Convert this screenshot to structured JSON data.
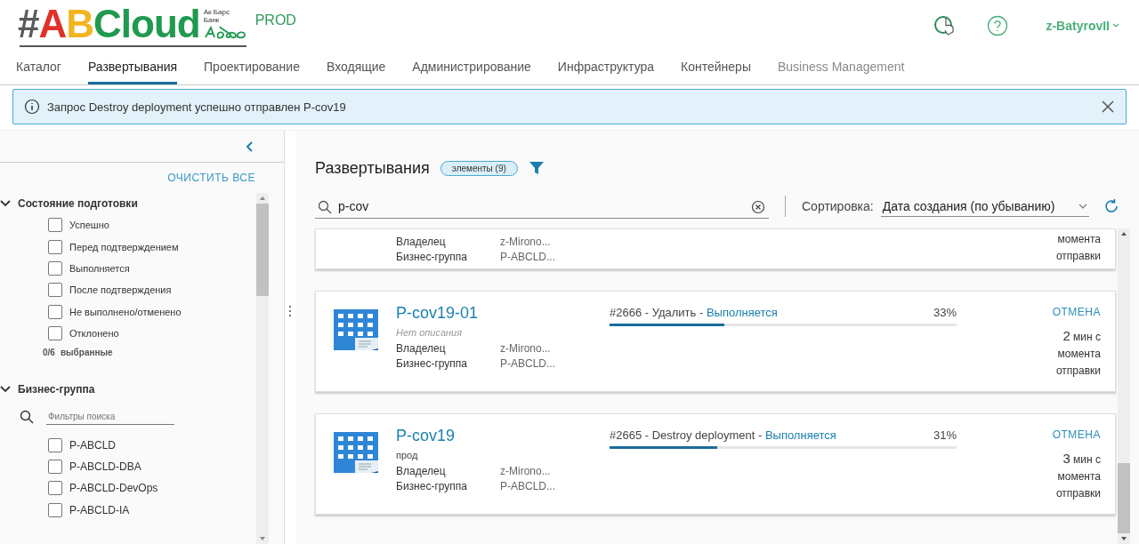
{
  "header": {
    "logo_parts": [
      {
        "text": "#",
        "color": "#5a5a5a"
      },
      {
        "text": "A",
        "color": "#e0302a"
      },
      {
        "text": "B",
        "color": "#f2b520"
      },
      {
        "text": "Cloud",
        "color": "#1f9a4e"
      }
    ],
    "bank_name": "Ак Барс Банк",
    "environment": "PROD",
    "user": "z-BatyrovII"
  },
  "tabs": [
    {
      "label": "Каталог",
      "selected": false,
      "disabled": false
    },
    {
      "label": "Развертывания",
      "selected": true,
      "disabled": false
    },
    {
      "label": "Проектирование",
      "selected": false,
      "disabled": false
    },
    {
      "label": "Входящие",
      "selected": false,
      "disabled": false
    },
    {
      "label": "Администрирование",
      "selected": false,
      "disabled": false
    },
    {
      "label": "Инфраструктура",
      "selected": false,
      "disabled": false
    },
    {
      "label": "Контейнеры",
      "selected": false,
      "disabled": false
    },
    {
      "label": "Business Management",
      "selected": false,
      "disabled": true
    }
  ],
  "alert": {
    "message": "Запрос Destroy deployment успешно отправлен P-cov19"
  },
  "sidebar": {
    "clear_all": "ОЧИСТИТЬ ВСЕ",
    "groups": [
      {
        "title": "Состояние подготовки",
        "expanded": true,
        "items": [
          {
            "label": "Успешно",
            "checked": false
          },
          {
            "label": "Перед подтверждением",
            "checked": false
          },
          {
            "label": "Выполняется",
            "checked": false
          },
          {
            "label": "После подтверждения",
            "checked": false
          },
          {
            "label": "Не выполнено/отменено",
            "checked": false
          },
          {
            "label": "Отклонено",
            "checked": false
          }
        ],
        "count": "0/6",
        "count_label": "выбранные"
      },
      {
        "title": "Бизнес-группа",
        "expanded": true,
        "search_placeholder": "Фильтры поиска",
        "items": [
          {
            "label": "P-ABCLD",
            "checked": false
          },
          {
            "label": "P-ABCLD-DBA",
            "checked": false
          },
          {
            "label": "P-ABCLD-DevOps",
            "checked": false
          },
          {
            "label": "P-ABCLD-IA",
            "checked": false
          }
        ]
      }
    ]
  },
  "main": {
    "title": "Развертывания",
    "items_badge": "элементы (9)",
    "search_value": "p-cov",
    "sort_label": "Сортировка:",
    "sort_value": "Дата создания (по убыванию)",
    "partial_card": {
      "owner_label": "Владелец",
      "owner": "z-Mirono...",
      "group_label": "Бизнес-группа",
      "group": "P-ABCLD...",
      "time_text": "момента отправки"
    },
    "deployments": [
      {
        "name": "P-cov19-01",
        "no_description": "Нет описания",
        "owner_label": "Владелец",
        "owner": "z-Mirono...",
        "group_label": "Бизнес-группа",
        "group": "P-ABCLD...",
        "request": "#2666 - Удалить -",
        "status": "Выполняется",
        "percent": "33%",
        "level": 0.33,
        "action": "ОТМЕНА",
        "time_value": "2",
        "time_text": "мин с момента отправки"
      },
      {
        "name": "P-cov19",
        "description": "прод",
        "owner_label": "Владелец",
        "owner": "z-Mirono...",
        "group_label": "Бизнес-группа",
        "group": "P-ABCLD...",
        "request": "#2665 - Destroy deployment -",
        "status": "Выполняется",
        "percent": "31%",
        "level": 0.31,
        "action": "ОТМЕНА",
        "time_value": "3",
        "time_text": "мин с момента отправки"
      }
    ]
  }
}
